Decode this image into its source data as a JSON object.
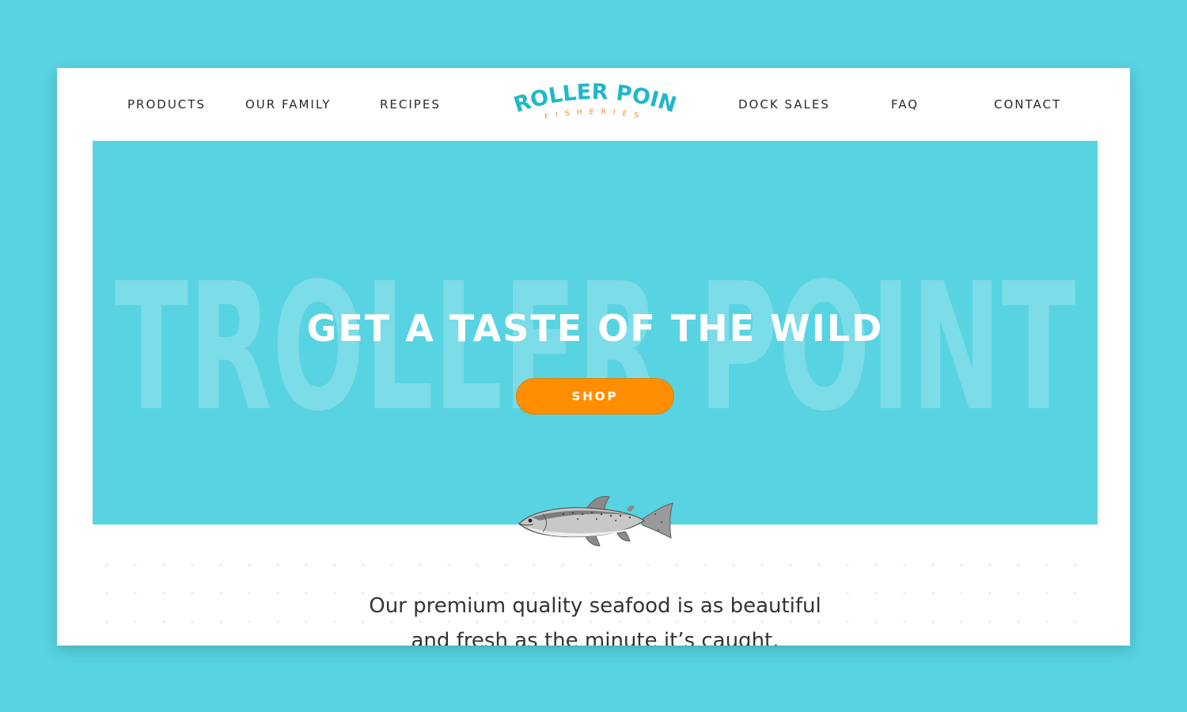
{
  "nav": {
    "left_items": [
      "PRODUCTS",
      "OUR FAMILY",
      "RECIPES"
    ],
    "right_items": [
      "DOCK SALES",
      "FAQ",
      "CONTACT"
    ]
  },
  "logo": {
    "name": "TROLLER POINT",
    "tagline": "FISHERIES",
    "primary_color": "#1fb8c9",
    "accent_color": "#f08a1c"
  },
  "hero": {
    "watermark": "TROLLER POINT",
    "title": "GET A TASTE OF THE WILD",
    "button_label": "SHOP",
    "background_color": "#58d3e2",
    "button_color": "#ff8f00"
  },
  "fish": {
    "icon": "salmon-illustration"
  },
  "intro": {
    "line1": "Our premium quality seafood is as beautiful",
    "line2": "and fresh as the minute it’s caught."
  }
}
